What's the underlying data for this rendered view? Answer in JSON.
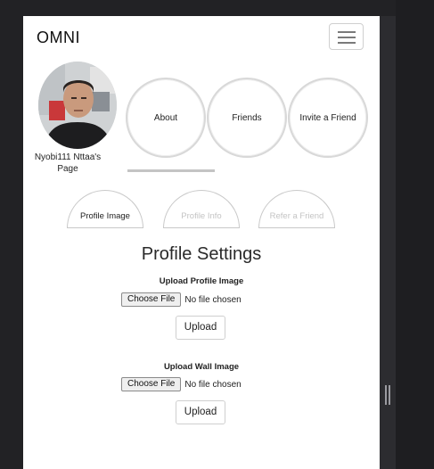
{
  "navbar": {
    "brand": "OMNI",
    "menu_icon": "hamburger-menu-icon"
  },
  "profile": {
    "name": "Nyobi111 Nttaa's Page",
    "avatar_icon": "avatar-photo"
  },
  "circle_nav": [
    {
      "label": "About"
    },
    {
      "label": "Friends"
    },
    {
      "label": "Invite a Friend"
    }
  ],
  "sub_tabs": [
    {
      "label": "Profile Image",
      "active": true
    },
    {
      "label": "Profile Info",
      "active": false
    },
    {
      "label": "Refer a Friend",
      "active": false
    }
  ],
  "settings": {
    "title": "Profile Settings",
    "profile_image": {
      "label": "Upload Profile Image",
      "choose_label": "Choose File",
      "status": "No file chosen",
      "upload_label": "Upload"
    },
    "wall_image": {
      "label": "Upload Wall Image",
      "choose_label": "Choose File",
      "status": "No file chosen",
      "upload_label": "Upload"
    }
  },
  "colors": {
    "page_bg": "#ffffff",
    "frame_bg": "#222225",
    "circle_border": "#d8d8d8",
    "inactive_text": "#c4c4c4"
  }
}
